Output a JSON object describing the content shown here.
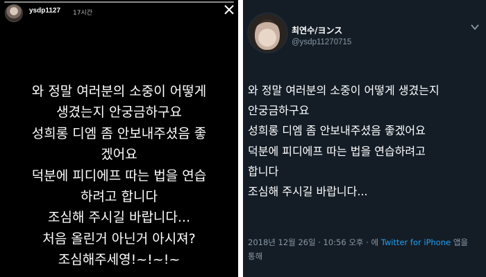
{
  "story": {
    "username": "ysdp1127",
    "time_ago": "17시간",
    "close_icon": "close-icon",
    "lines": [
      "와 정말 여러분의 소중이 어떻게",
      "생겼는지 안궁금하구요",
      "성희롱 디엠 좀 안보내주셨음 좋",
      "겠어요",
      "덕분에 피디에프 따는 법을 연습",
      "하려고 합니다",
      "조심해 주시길 바랍니다...",
      "처음 올린거 아닌거 아시져?",
      "조심해주세영!~!~!~"
    ]
  },
  "tweet": {
    "display_name": "최연수/ヨンス",
    "handle": "@ysdp11270715",
    "lines": [
      "와 정말 여러분의 소중이 어떻게 생겼는지",
      "안궁금하구요",
      "성희롱 디엠 좀 안보내주셨음 좋겠어요",
      "덕분에 피디에프 따는 법을 연습하려고",
      "합니다",
      "조심해 주시길 바랍니다..."
    ],
    "timestamp": "2018년 12월 26일 · 10:56 오후 · 에",
    "via": "Twitter for iPhone",
    "via_suffix": "앱을",
    "via_line2": "통해",
    "colors": {
      "background": "#141d26",
      "link": "#1da1f2",
      "muted": "#8899a6"
    }
  }
}
